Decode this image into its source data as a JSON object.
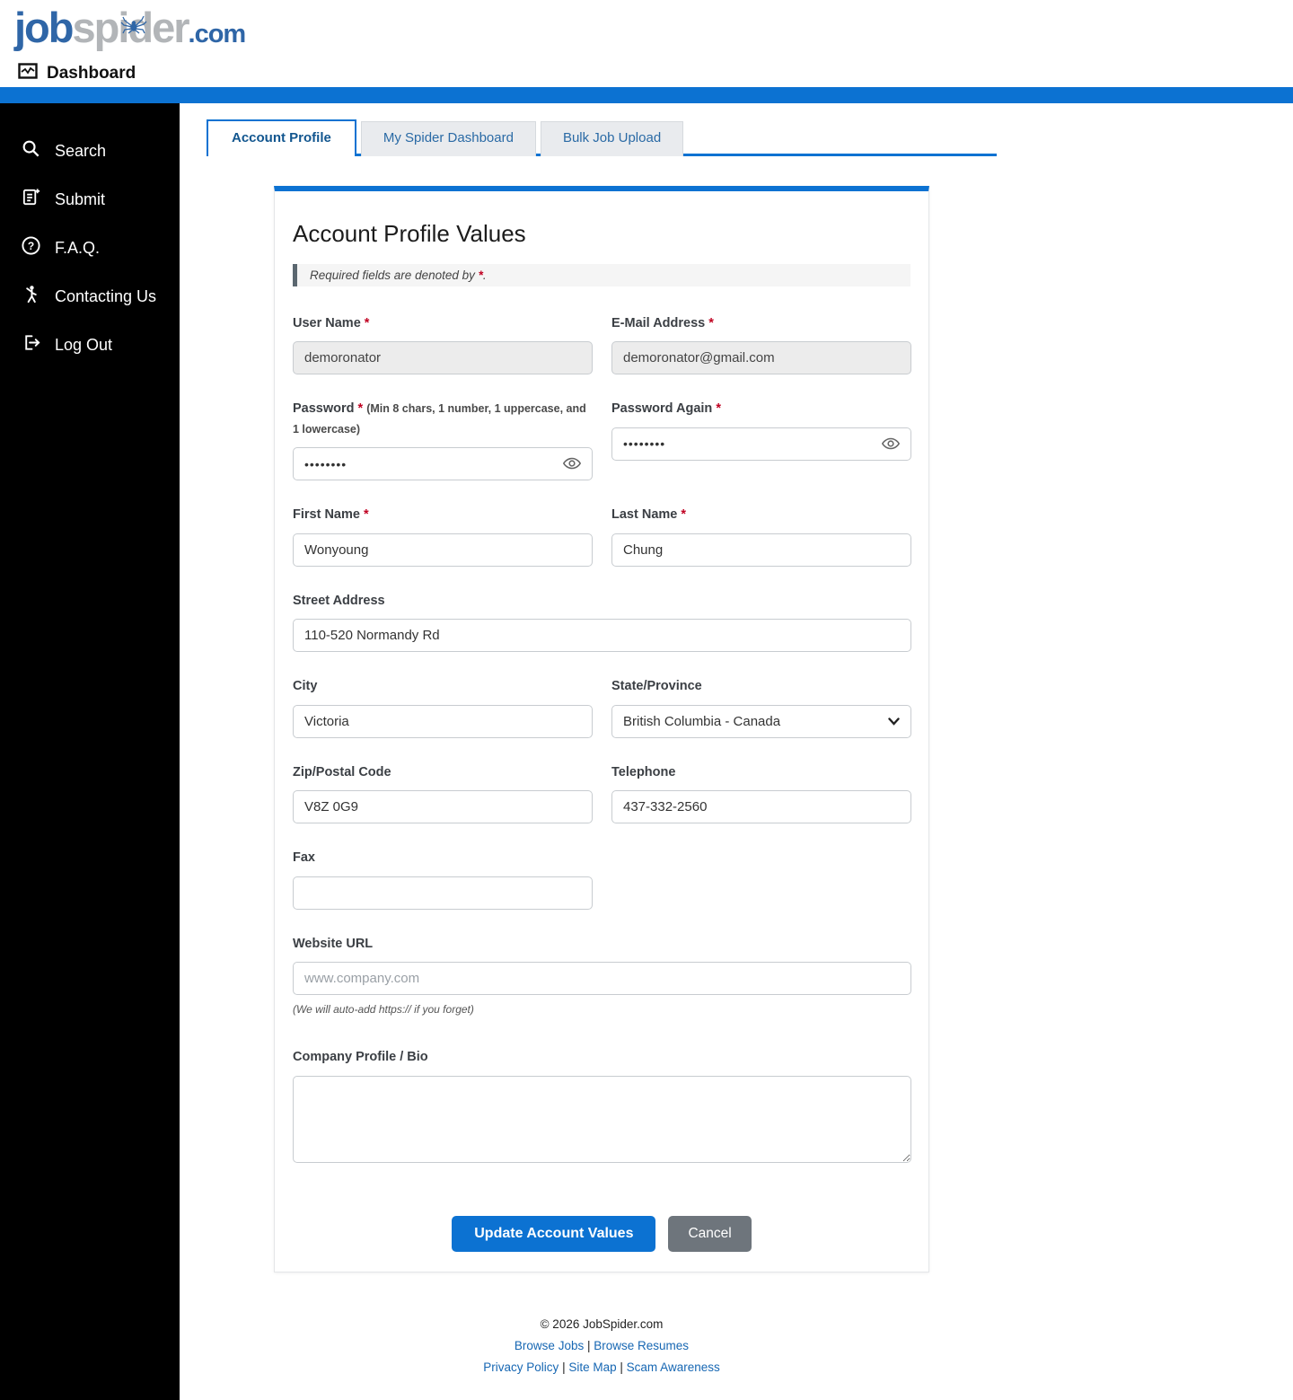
{
  "header": {
    "logo_job": "job",
    "logo_spider": "spider",
    "logo_tld": ".com",
    "dashboard_label": "Dashboard"
  },
  "colors": {
    "accent": "#0c72d2",
    "logo_blue": "#2f66a7",
    "logo_gray": "#b2b5b8",
    "required_red": "#c00021"
  },
  "sidebar": {
    "items": [
      {
        "label": "Search",
        "icon": "search-icon"
      },
      {
        "label": "Submit",
        "icon": "submit-document-icon"
      },
      {
        "label": "F.A.Q.",
        "icon": "question-circle-icon"
      },
      {
        "label": "Contacting Us",
        "icon": "person-waving-icon"
      },
      {
        "label": "Log Out",
        "icon": "logout-icon"
      }
    ]
  },
  "tabs": {
    "account_profile": "Account Profile",
    "my_spider_dashboard": "My Spider Dashboard",
    "bulk_job_upload": "Bulk Job Upload"
  },
  "form": {
    "title": "Account Profile Values",
    "required_note_text": "Required fields are denoted by",
    "required_star": "*",
    "required_note_period": ".",
    "fields": {
      "user_name": {
        "label": "User Name",
        "star": "*",
        "value": "demoronator"
      },
      "email": {
        "label": "E-Mail Address",
        "star": "*",
        "value": "demoronator@gmail.com"
      },
      "password": {
        "label": "Password",
        "star": "*",
        "hint": "(Min 8 chars, 1 number, 1 uppercase, and 1 lowercase)",
        "value": "••••••••"
      },
      "password_again": {
        "label": "Password Again",
        "star": "*",
        "value": "••••••••"
      },
      "first_name": {
        "label": "First Name",
        "star": "*",
        "value": "Wonyoung"
      },
      "last_name": {
        "label": "Last Name",
        "star": "*",
        "value": "Chung"
      },
      "street_address": {
        "label": "Street Address",
        "value": "110-520 Normandy Rd"
      },
      "city": {
        "label": "City",
        "value": "Victoria"
      },
      "state_province": {
        "label": "State/Province",
        "value": "British Columbia - Canada"
      },
      "zip": {
        "label": "Zip/Postal Code",
        "value": "V8Z 0G9"
      },
      "telephone": {
        "label": "Telephone",
        "value": "437-332-2560"
      },
      "fax": {
        "label": "Fax",
        "value": ""
      },
      "website": {
        "label": "Website URL",
        "placeholder": "www.company.com",
        "hint": "(We will auto-add https:// if you forget)"
      },
      "bio": {
        "label": "Company Profile / Bio",
        "value": ""
      }
    },
    "buttons": {
      "update": "Update Account Values",
      "cancel": "Cancel"
    }
  },
  "footer": {
    "copyright": "© 2026 JobSpider.com",
    "separator": "|",
    "links_row1": [
      {
        "label": "Browse Jobs"
      },
      {
        "label": "Browse Resumes"
      }
    ],
    "links_row2": [
      {
        "label": "Privacy Policy"
      },
      {
        "label": "Site Map"
      },
      {
        "label": "Scam Awareness"
      }
    ]
  }
}
